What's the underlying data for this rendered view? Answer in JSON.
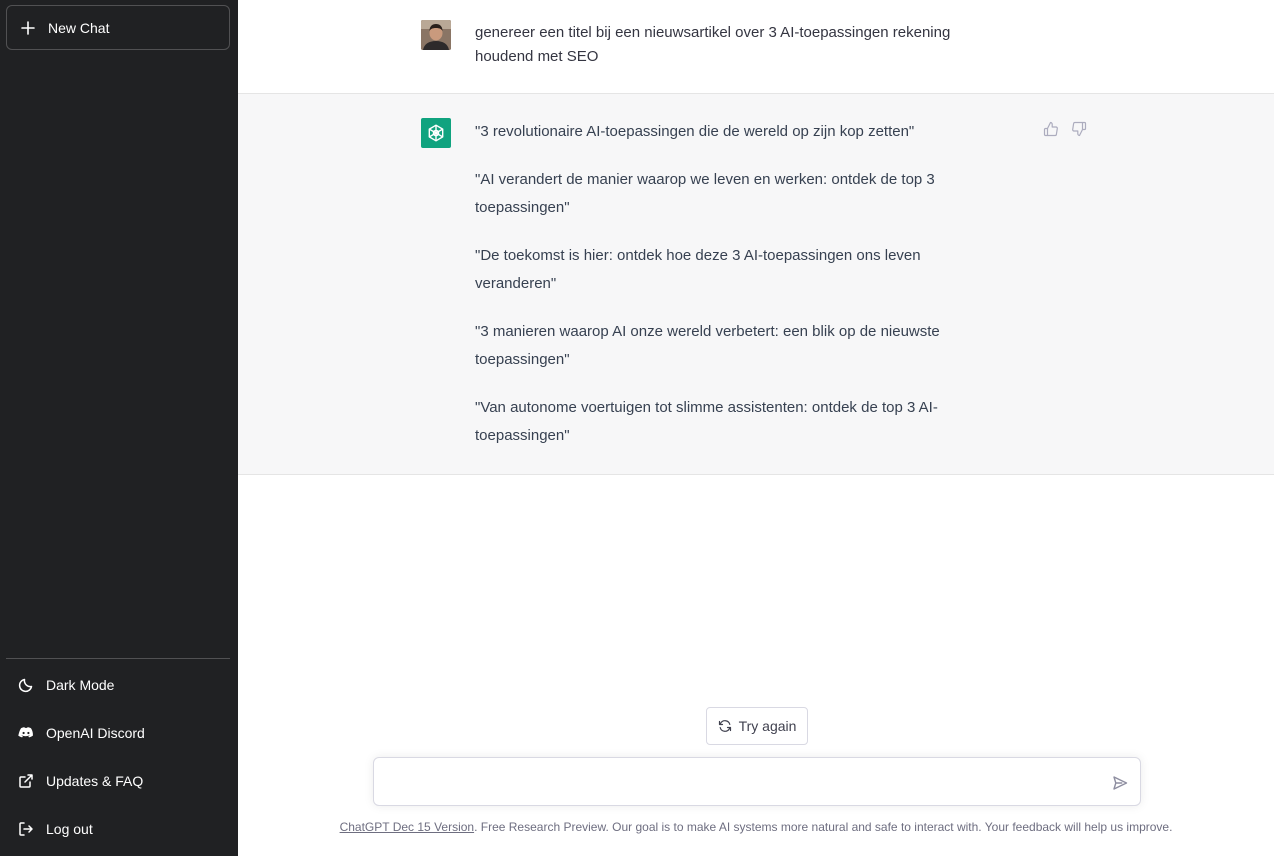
{
  "sidebar": {
    "new_chat_label": "New Chat",
    "items": [
      {
        "label": "Dark Mode",
        "icon": "moon-icon"
      },
      {
        "label": "OpenAI Discord",
        "icon": "discord-icon"
      },
      {
        "label": "Updates & FAQ",
        "icon": "external-link-icon"
      },
      {
        "label": "Log out",
        "icon": "logout-icon"
      }
    ]
  },
  "conversation": {
    "user_message": "genereer een titel bij een nieuwsartikel over 3 AI-toepassingen rekening houdend met SEO",
    "assistant_messages": [
      "\"3 revolutionaire AI-toepassingen die de wereld op zijn kop zetten\"",
      "\"AI verandert de manier waarop we leven en werken: ontdek de top 3 toepassingen\"",
      "\"De toekomst is hier: ontdek hoe deze 3 AI-toepassingen ons leven veranderen\"",
      "\"3 manieren waarop AI onze wereld verbetert: een blik op de nieuwste toepassingen\"",
      "\"Van autonome voertuigen tot slimme assistenten: ontdek de top 3 AI-toepassingen\""
    ]
  },
  "actions": {
    "try_again_label": "Try again"
  },
  "input": {
    "value": "",
    "placeholder": ""
  },
  "footer": {
    "version_link": "ChatGPT Dec 15 Version",
    "text": ". Free Research Preview. Our goal is to make AI systems more natural and safe to interact with. Your feedback will help us improve."
  },
  "colors": {
    "sidebar_bg": "#202123",
    "assistant_row_bg": "#f7f7f8",
    "brand_green": "#10a37f"
  }
}
